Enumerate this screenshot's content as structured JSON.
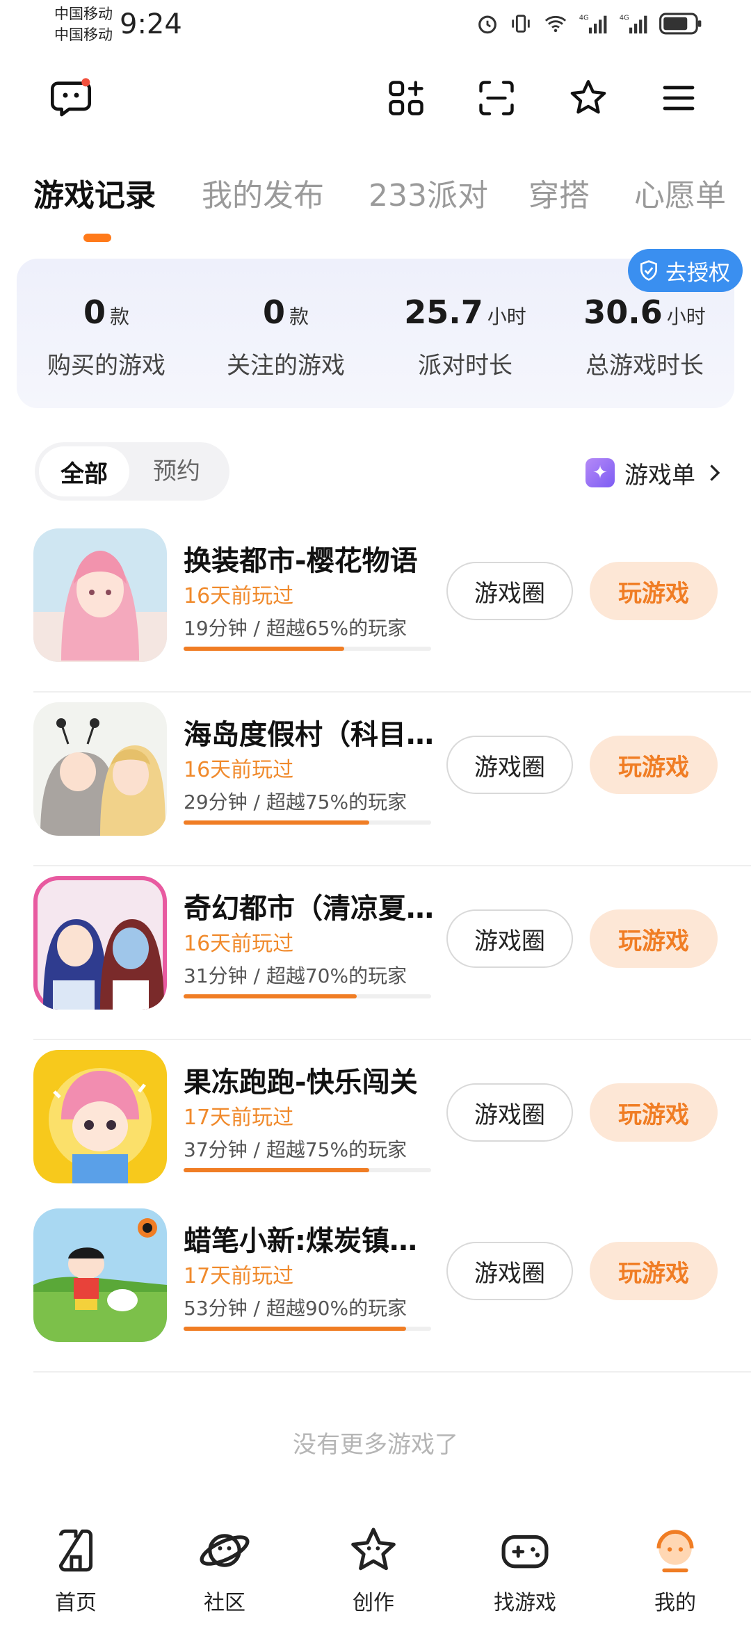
{
  "status_bar": {
    "carrier_1": "中国移动",
    "carrier_2": "中国移动",
    "time": "9:24"
  },
  "tabs": [
    "游戏记录",
    "我的发布",
    "233派对",
    "穿搭",
    "心愿单"
  ],
  "stats": {
    "auth_label": "去授权",
    "items": [
      {
        "value": "0",
        "unit": "款",
        "label": "购买的游戏"
      },
      {
        "value": "0",
        "unit": "款",
        "label": "关注的游戏"
      },
      {
        "value": "25.7",
        "unit": "小时",
        "label": "派对时长"
      },
      {
        "value": "30.6",
        "unit": "小时",
        "label": "总游戏时长"
      }
    ]
  },
  "filters": {
    "selected": "全部",
    "other": "预约",
    "game_list_link": "游戏单"
  },
  "games": [
    {
      "name": "换装都市-樱花物语",
      "last_played": "16天前玩过",
      "stats": "19分钟 / 超越65%的玩家",
      "progress": 0.65,
      "circle_label": "游戏圈",
      "play_label": "玩游戏"
    },
    {
      "name": "海岛度假村（科目…",
      "last_played": "16天前玩过",
      "stats": "29分钟 / 超越75%的玩家",
      "progress": 0.75,
      "circle_label": "游戏圈",
      "play_label": "玩游戏"
    },
    {
      "name": "奇幻都市（清凉夏…",
      "last_played": "16天前玩过",
      "stats": "31分钟 / 超越70%的玩家",
      "progress": 0.7,
      "circle_label": "游戏圈",
      "play_label": "玩游戏"
    },
    {
      "name": "果冻跑跑-快乐闯关",
      "last_played": "17天前玩过",
      "stats": "37分钟 / 超越75%的玩家",
      "progress": 0.75,
      "circle_label": "游戏圈",
      "play_label": "玩游戏"
    },
    {
      "name": "蜡笔小新:煤炭镇…",
      "last_played": "17天前玩过",
      "stats": "53分钟 / 超越90%的玩家",
      "progress": 0.9,
      "circle_label": "游戏圈",
      "play_label": "玩游戏"
    }
  ],
  "no_more_text": "没有更多游戏了",
  "bottom_nav": [
    {
      "label": "首页",
      "icon": "home-icon"
    },
    {
      "label": "社区",
      "icon": "planet-icon"
    },
    {
      "label": "创作",
      "icon": "star-icon"
    },
    {
      "label": "找游戏",
      "icon": "gamepad-icon"
    },
    {
      "label": "我的",
      "icon": "profile-icon",
      "active": true
    }
  ],
  "colors": {
    "accent": "#f07d24",
    "auth_badge": "#3a8ff0"
  }
}
